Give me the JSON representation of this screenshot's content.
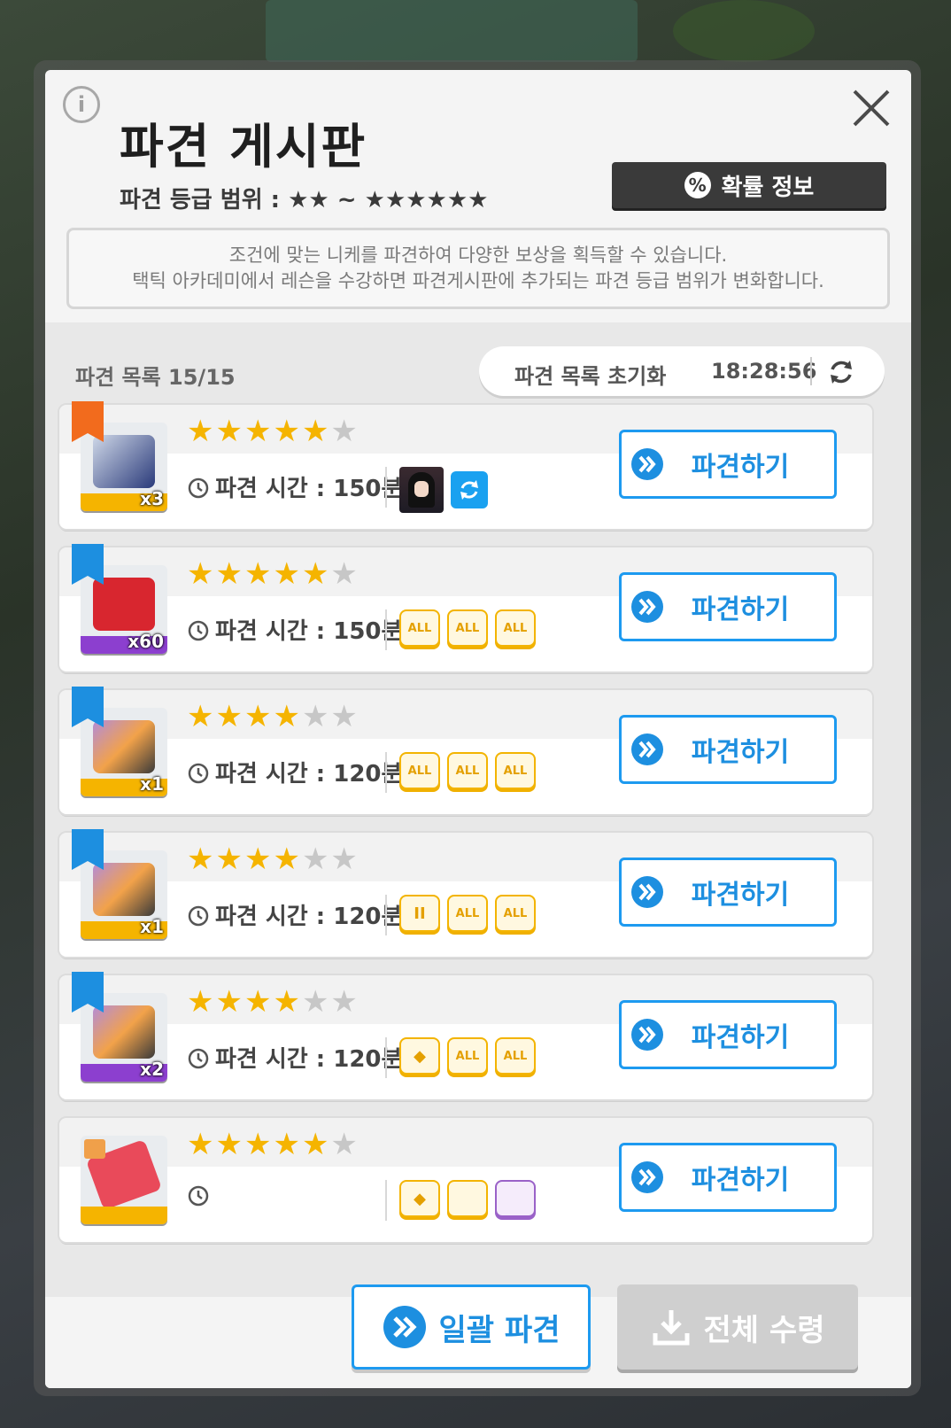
{
  "header": {
    "title": "파견 게시판",
    "grade_range": "파견 등급 범위 : ★★ ~ ★★★★★★",
    "prob_info_label": "확률 정보",
    "description_line1": "조건에 맞는 니케를 파견하여 다양한 보상을 획득할 수 있습니다.",
    "description_line2": "택틱 아카데미에서 레슨을 수강하면 파견게시판에 추가되는 파견 등급 범위가 변화합니다."
  },
  "list": {
    "count_label": "파견 목록 15/15",
    "reset_label": "파견 목록 초기화",
    "reset_timer": "18:28:56"
  },
  "dispatches": [
    {
      "stars": 5,
      "max_stars": 6,
      "time": "파견 시간 : 150분",
      "qty": "x3",
      "bar": "#f5b400",
      "ribbon": "#f26b1d",
      "item": "glue-bottle-icon",
      "button": "파견하기",
      "conds": []
    },
    {
      "stars": 5,
      "max_stars": 6,
      "time": "파견 시간 : 150분",
      "qty": "x60",
      "bar": "#8c3fcf",
      "ribbon": "#1d8fe0",
      "item": "lucky-box-icon",
      "button": "파견하기",
      "conds": [
        "ALL",
        "ALL",
        "ALL"
      ]
    },
    {
      "stars": 4,
      "max_stars": 6,
      "time": "파견 시간 : 120분",
      "qty": "x1",
      "bar": "#f5b400",
      "ribbon": "#1d8fe0",
      "item": "treasure-case-icon",
      "button": "파견하기",
      "conds": [
        "ALL",
        "ALL",
        "ALL"
      ]
    },
    {
      "stars": 4,
      "max_stars": 6,
      "time": "파견 시간 : 120분",
      "qty": "x1",
      "bar": "#f5b400",
      "ribbon": "#1d8fe0",
      "item": "treasure-case-icon",
      "button": "파견하기",
      "conds": [
        "II",
        "ALL",
        "ALL"
      ]
    },
    {
      "stars": 4,
      "max_stars": 6,
      "time": "파견 시간 : 120분",
      "qty": "x2",
      "bar": "#8c3fcf",
      "ribbon": "#1d8fe0",
      "item": "treasure-case-icon",
      "button": "파견하기",
      "conds": [
        "◆",
        "ALL",
        "ALL"
      ]
    },
    {
      "stars": 5,
      "max_stars": 6,
      "time": "",
      "qty": "",
      "bar": "#f5b400",
      "ribbon": "",
      "item": "ticket-icon",
      "button": "파견하기",
      "conds": [
        "◆",
        "",
        ""
      ]
    }
  ],
  "footer": {
    "bulk_label": "일괄 파견",
    "receive_all_label": "전체 수령"
  },
  "colors": {
    "accent_blue": "#1d8fe0",
    "star_gold": "#f5b400",
    "dark_button": "#3a3a3a"
  }
}
